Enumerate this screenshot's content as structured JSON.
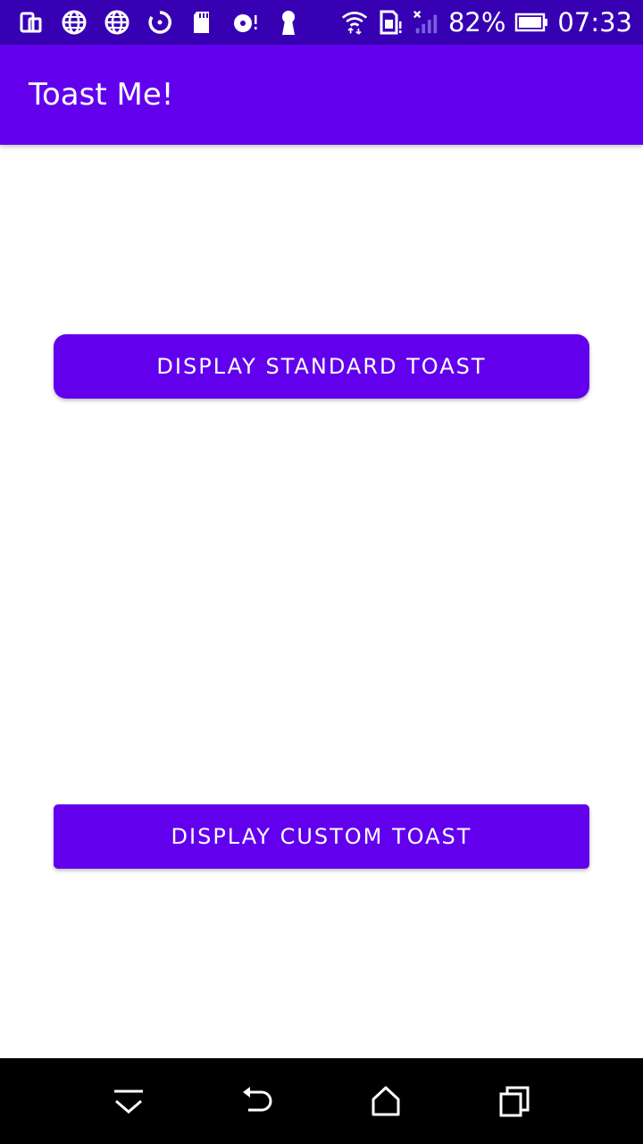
{
  "status_bar": {
    "icons_left": [
      "screen-share-icon",
      "globe-icon",
      "globe-icon",
      "sync-icon",
      "sd-card-icon",
      "disc-alert-icon",
      "keyhole-icon"
    ],
    "icons_right": [
      "wifi-icon",
      "sim-alert-icon",
      "signal-icon",
      "battery-icon"
    ],
    "battery": "82%",
    "time": "07:33"
  },
  "app_bar": {
    "title": "Toast Me!"
  },
  "main": {
    "standard_button_label": "DISPLAY STANDARD TOAST",
    "custom_button_label": "DISPLAY CUSTOM TOAST"
  },
  "nav_bar": {
    "icons": [
      "collapse-icon",
      "back-icon",
      "home-icon",
      "recents-icon"
    ]
  },
  "colors": {
    "status_bar": "#3700b3",
    "primary": "#6200ee",
    "nav_bar": "#000000",
    "background": "#ffffff"
  }
}
